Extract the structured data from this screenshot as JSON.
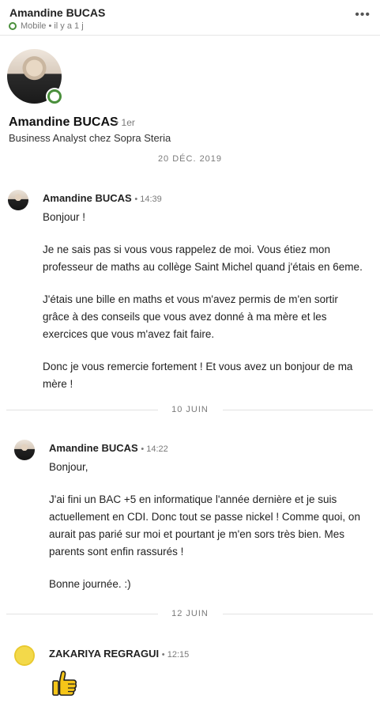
{
  "header": {
    "name": "Amandine BUCAS",
    "status": "Mobile • il y a 1 j"
  },
  "profile": {
    "name": "Amandine BUCAS",
    "degree": "• 1er",
    "headline": "Business Analyst chez Sopra Steria"
  },
  "dates": {
    "first": "20 DÉC. 2019",
    "second": "10 JUIN",
    "third": "12 JUIN"
  },
  "messages": [
    {
      "sender": "Amandine BUCAS",
      "time": "• 14:39",
      "p1": "Bonjour !",
      "p2": "Je ne sais pas si vous vous rappelez de moi. Vous étiez mon professeur de maths au collège Saint Michel quand j'étais en 6eme.",
      "p3": "J'étais une bille en maths et vous m'avez permis de m'en sortir grâce à des conseils que vous avez donné à ma mère et les exercices que vous m'avez fait faire.",
      "p4": "Donc je vous remercie fortement ! Et vous avez un bonjour de ma mère !"
    },
    {
      "sender": "Amandine BUCAS",
      "time": "• 14:22",
      "p1": "Bonjour,",
      "p2": "J'ai fini un BAC +5 en informatique l'année dernière et je suis actuellement en CDI. Donc tout se passe nickel ! Comme quoi, on aurait pas parié sur moi et pourtant je m'en sors très bien. Mes parents sont enfin rassurés !",
      "p3": "Bonne journée. :)"
    },
    {
      "sender": "ZAKARIYA REGRAGUI",
      "time": "• 12:15",
      "reaction": "thumbs-up"
    }
  ],
  "colors": {
    "online": "#4a8f3c",
    "thumb": "#f5c518"
  }
}
